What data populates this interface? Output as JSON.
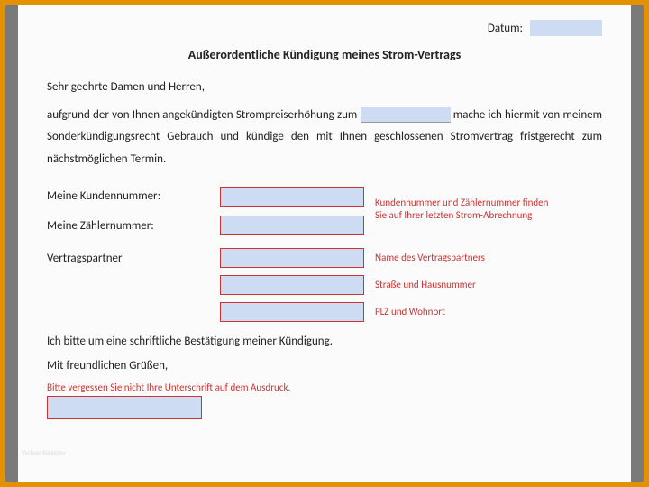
{
  "date": {
    "label": "Datum:"
  },
  "title": "Außerordentliche Kündigung meines Strom-Vertrags",
  "salutation": "Sehr geehrte Damen und Herren,",
  "para1a": "aufgrund der von Ihnen angekündigten Strompreiserhöhung zum ",
  "para1b": " mache ich hiermit von meinem Sonderkündigungsrecht Gebrauch und kündige den mit Ihnen geschlossenen Stromvertrag fristgerecht zum nächstmöglichen Termin.",
  "rows": {
    "kundennr": {
      "label": "Meine Kundennummer:",
      "hint": "Kundennummer und Zählernummer finden Sie auf Ihrer letzten Strom-Abrechnung"
    },
    "zaehlernr": {
      "label": "Meine Zählernummer:"
    },
    "partner": {
      "label": "Vertragspartner",
      "hint": "Name des Vertragspartners"
    },
    "strasse": {
      "hint": "Straße und Hausnummer"
    },
    "ort": {
      "hint": "PLZ und Wohnort"
    }
  },
  "confirm": "Ich bitte um eine schriftliche Bestätigung meiner Kündigung.",
  "signoff": "Mit freundlichen Grüßen,",
  "sig_hint": "Bitte vergessen Sie nicht Ihre Unterschrift auf dem Ausdruck.",
  "watermark": "Vorlage Ratgeber"
}
